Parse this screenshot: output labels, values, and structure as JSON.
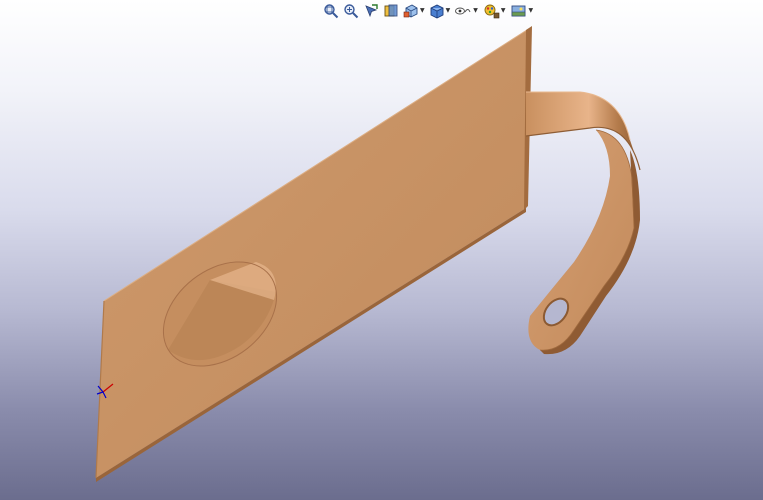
{
  "window": {
    "type": "cad-graphics-area"
  },
  "toolbar": {
    "buttons": [
      {
        "name": "zoom-to-fit-icon"
      },
      {
        "name": "zoom-to-area-icon"
      },
      {
        "name": "previous-view-icon"
      },
      {
        "name": "section-view-icon"
      },
      {
        "name": "view-orientation-icon",
        "dropdown": true
      },
      {
        "name": "display-style-icon",
        "dropdown": true
      },
      {
        "name": "hide-show-items-icon",
        "dropdown": true
      },
      {
        "name": "edit-appearance-icon",
        "dropdown": true
      },
      {
        "name": "apply-scene-icon",
        "dropdown": true
      }
    ],
    "dropdown_glyph": "▼"
  },
  "model": {
    "description": "sheet-metal-bracket",
    "part_color": "#c99264",
    "shadow_color": "#a8714a",
    "highlight_color": "#e3b088"
  },
  "triad": {
    "x_color": "#cc0000",
    "y_color": "#008800",
    "z_color": "#0000cc"
  }
}
